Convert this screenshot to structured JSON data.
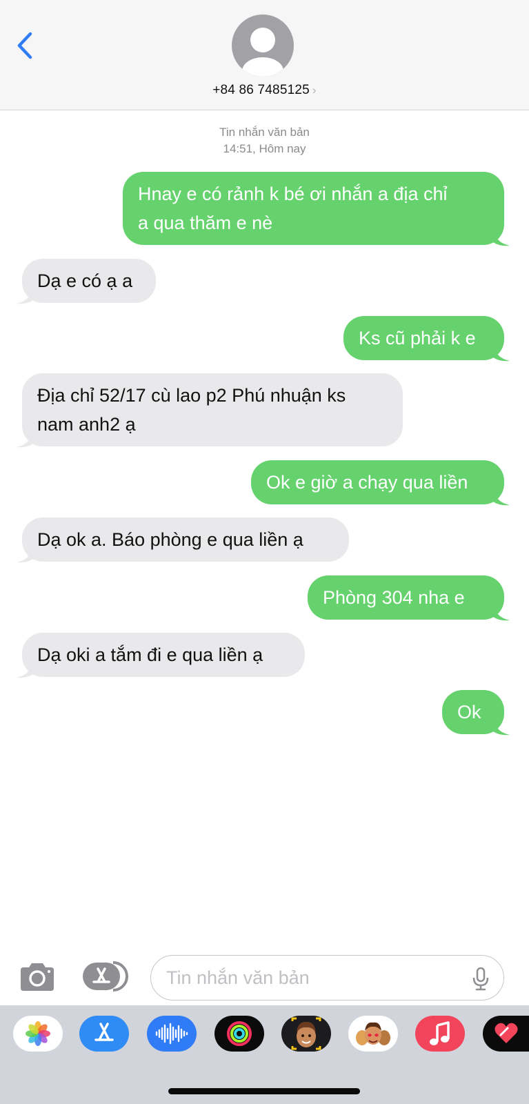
{
  "header": {
    "back_label": "",
    "contact_number": "+84 86 7485125",
    "chevron": "›"
  },
  "thread_meta": {
    "type_label": "Tin nhắn văn bản",
    "time_label": "14:51, Hôm nay"
  },
  "messages": [
    {
      "direction": "sent",
      "lines": [
        "Hnay e có rảnh k bé ơi nhắn a địa chỉ",
        "a qua thăm e nè"
      ]
    },
    {
      "direction": "received",
      "lines": [
        "Dạ e có ạ a"
      ]
    },
    {
      "direction": "sent",
      "lines": [
        "Ks cũ phải k e"
      ]
    },
    {
      "direction": "received",
      "lines": [
        "Địa chỉ 52/17 cù lao p2 Phú nhuận ks",
        "nam anh2 ạ"
      ]
    },
    {
      "direction": "sent",
      "lines": [
        "Ok e giờ a chạy qua liền"
      ]
    },
    {
      "direction": "received",
      "lines": [
        "Dạ ok a. Báo phòng e qua liền ạ"
      ]
    },
    {
      "direction": "sent",
      "lines": [
        "Phòng 304 nha e"
      ]
    },
    {
      "direction": "received",
      "lines": [
        "Dạ oki a tắm đi e qua liền ạ"
      ]
    },
    {
      "direction": "sent",
      "lines": [
        "Ok"
      ]
    }
  ],
  "composer": {
    "placeholder": "Tin nhắn văn bản",
    "value": ""
  },
  "app_strip": [
    {
      "icon": "photos-icon"
    },
    {
      "icon": "app-store-icon"
    },
    {
      "icon": "audio-message-icon"
    },
    {
      "icon": "activity-icon"
    },
    {
      "icon": "memoji-icon"
    },
    {
      "icon": "memoji-stickers-icon"
    },
    {
      "icon": "music-icon"
    },
    {
      "icon": "digital-touch-icon"
    }
  ],
  "colors": {
    "sent_bubble": "#65d26e",
    "received_bubble": "#e9e9eb",
    "accent": "#2f7cf6",
    "header_bg": "#f6f6f6"
  }
}
